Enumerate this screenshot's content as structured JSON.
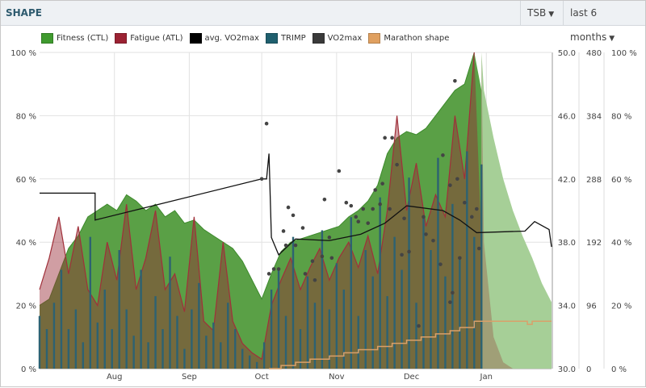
{
  "header": {
    "title": "SHAPE",
    "metric_select": "TSB",
    "range_select": "last 6 months"
  },
  "colors": {
    "ctl": "#5aa046",
    "ctl_proj": "#a6cf97",
    "atl": "#8c2a35",
    "avg_vo2": "#111111",
    "trimp": "#2d6272",
    "vo2": "#444444",
    "marathon": "#d9a06a"
  },
  "chart_data": {
    "type": "line",
    "legend": [
      {
        "label": "Fitness (CTL)",
        "color": "#3f9a2e"
      },
      {
        "label": "Fatigue (ATL)",
        "color": "#9b2233"
      },
      {
        "label": "avg. VO2max",
        "color": "#000000"
      },
      {
        "label": "TRIMP",
        "color": "#1f5f6e"
      },
      {
        "label": "VO2max",
        "color": "#3a3a3a"
      },
      {
        "label": "Marathon shape",
        "color": "#e0a060"
      }
    ],
    "legend_position": "top-left",
    "x_unit": "day index from Jul 1",
    "x_range": [
      0,
      212
    ],
    "x_ticks": [
      {
        "day": 31,
        "label": "Aug"
      },
      {
        "day": 62,
        "label": "Sep"
      },
      {
        "day": 92,
        "label": "Oct"
      },
      {
        "day": 123,
        "label": "Nov"
      },
      {
        "day": 154,
        "label": "Dec"
      },
      {
        "day": 185,
        "label": "Jan"
      }
    ],
    "left_axis": {
      "range": [
        0,
        100
      ],
      "ticks": [
        "0 %",
        "20 %",
        "40 %",
        "60 %",
        "80 %",
        "100 %"
      ]
    },
    "vo2_axis": {
      "range": [
        30,
        50
      ],
      "ticks": [
        "30.0",
        "34.0",
        "38.0",
        "42.0",
        "46.0",
        "50.0"
      ]
    },
    "trimp_axis": {
      "range": [
        0,
        480
      ],
      "ticks": [
        "0",
        "96",
        "192",
        "288",
        "384",
        "480"
      ]
    },
    "pct_axis": {
      "range": [
        0,
        100
      ],
      "ticks": [
        "0 %",
        "20 %",
        "40 %",
        "60 %",
        "80 %",
        "100 %"
      ]
    },
    "forecast_from_day": 183,
    "ctl": {
      "step": 4,
      "values": [
        20,
        22,
        30,
        38,
        42,
        48,
        50,
        52,
        50,
        55,
        53,
        50,
        52,
        48,
        50,
        46,
        47,
        44,
        42,
        40,
        38,
        34,
        28,
        22,
        30,
        37,
        40,
        41,
        42,
        43,
        44,
        45,
        48,
        50,
        53,
        58,
        68,
        73,
        75,
        74,
        76,
        80,
        84,
        88,
        90,
        100,
        88,
        73,
        60,
        50,
        42,
        35,
        27,
        21
      ]
    },
    "atl": {
      "step": 4,
      "values": [
        25,
        35,
        48,
        30,
        45,
        25,
        20,
        40,
        28,
        52,
        25,
        35,
        50,
        25,
        30,
        18,
        48,
        15,
        12,
        40,
        15,
        8,
        5,
        3,
        20,
        28,
        35,
        25,
        32,
        38,
        28,
        35,
        40,
        32,
        42,
        30,
        50,
        80,
        50,
        65,
        45,
        55,
        48,
        80,
        60,
        100,
        40,
        10,
        2,
        0,
        0,
        0,
        0,
        0
      ]
    },
    "trimp": {
      "step": 3,
      "values": [
        80,
        60,
        100,
        150,
        60,
        90,
        40,
        200,
        70,
        120,
        60,
        180,
        90,
        50,
        150,
        40,
        110,
        60,
        170,
        80,
        30,
        90,
        130,
        50,
        70,
        40,
        100,
        60,
        30,
        20,
        10,
        40,
        120,
        150,
        80,
        200,
        60,
        140,
        100,
        210,
        90,
        160,
        120,
        230,
        80,
        180,
        140,
        260,
        110,
        200,
        150,
        290,
        100,
        230,
        180,
        320,
        140,
        250,
        170,
        330,
        200,
        310
      ]
    },
    "avg_vo2max": [
      [
        0,
        41.1
      ],
      [
        23,
        41.1
      ],
      [
        23,
        39.4
      ],
      [
        92,
        42.0
      ],
      [
        94,
        42.0
      ],
      [
        95,
        43.6
      ],
      [
        96,
        38.3
      ],
      [
        99,
        37.2
      ],
      [
        106,
        38.2
      ],
      [
        120,
        38.1
      ],
      [
        133,
        38.5
      ],
      [
        143,
        39.2
      ],
      [
        152,
        40.3
      ],
      [
        167,
        40.0
      ],
      [
        174,
        39.4
      ],
      [
        181,
        38.6
      ],
      [
        201,
        38.7
      ],
      [
        205,
        39.3
      ],
      [
        211,
        38.8
      ],
      [
        212,
        37.7
      ]
    ],
    "vo2max": [
      [
        92,
        42.0
      ],
      [
        94,
        45.5
      ],
      [
        95,
        36.0
      ],
      [
        97,
        36.3
      ],
      [
        99,
        36.3
      ],
      [
        101,
        38.7
      ],
      [
        102,
        37.8
      ],
      [
        103,
        40.2
      ],
      [
        105,
        39.7
      ],
      [
        106,
        37.8
      ],
      [
        109,
        38.9
      ],
      [
        110,
        36.0
      ],
      [
        113,
        36.8
      ],
      [
        114,
        35.6
      ],
      [
        117,
        37.1
      ],
      [
        118,
        40.7
      ],
      [
        120,
        38.3
      ],
      [
        121,
        37.0
      ],
      [
        124,
        42.5
      ],
      [
        127,
        40.5
      ],
      [
        129,
        40.3
      ],
      [
        131,
        39.6
      ],
      [
        132,
        39.3
      ],
      [
        134,
        40.1
      ],
      [
        136,
        39.2
      ],
      [
        138,
        40.1
      ],
      [
        139,
        41.3
      ],
      [
        141,
        40.4
      ],
      [
        142,
        41.7
      ],
      [
        143,
        44.6
      ],
      [
        145,
        40.1
      ],
      [
        146,
        44.6
      ],
      [
        148,
        42.9
      ],
      [
        150,
        37.2
      ],
      [
        151,
        39.5
      ],
      [
        153,
        37.4
      ],
      [
        157,
        32.7
      ],
      [
        159,
        39.6
      ],
      [
        160,
        38.5
      ],
      [
        163,
        38.1
      ],
      [
        166,
        36.6
      ],
      [
        167,
        43.5
      ],
      [
        170,
        34.2
      ],
      [
        170,
        41.6
      ],
      [
        171,
        34.8
      ],
      [
        172,
        48.2
      ],
      [
        173,
        42.0
      ],
      [
        174,
        37.0
      ],
      [
        176,
        40.5
      ],
      [
        179,
        39.6
      ],
      [
        181,
        40.1
      ],
      [
        182,
        37.6
      ]
    ],
    "marathon_shape": [
      [
        95,
        0
      ],
      [
        100,
        1
      ],
      [
        106,
        2
      ],
      [
        112,
        3
      ],
      [
        120,
        4
      ],
      [
        126,
        5
      ],
      [
        132,
        6
      ],
      [
        140,
        7
      ],
      [
        146,
        8
      ],
      [
        152,
        9
      ],
      [
        158,
        10
      ],
      [
        164,
        11
      ],
      [
        170,
        12
      ],
      [
        174,
        13
      ],
      [
        180,
        15
      ],
      [
        200,
        15
      ],
      [
        202,
        14
      ],
      [
        204,
        15
      ],
      [
        212,
        15
      ]
    ]
  }
}
